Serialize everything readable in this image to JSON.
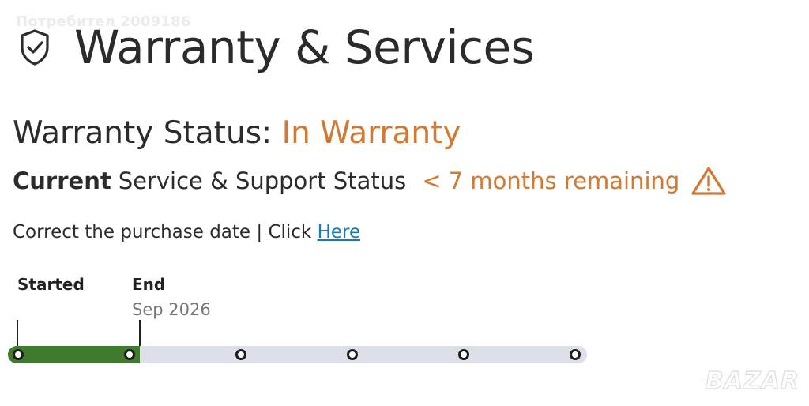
{
  "watermark_top": "Потребител 2009186",
  "header": {
    "icon": "shield-check-icon",
    "title": "Warranty & Services"
  },
  "warranty": {
    "label": "Warranty Status:",
    "value": "In Warranty"
  },
  "support": {
    "current": "Current",
    "label": "Service & Support Status",
    "remaining": "< 7 months remaining",
    "icon": "warning-icon"
  },
  "correct": {
    "text": "Correct the purchase date | Click",
    "link": "Here"
  },
  "timeline": {
    "start_label": "Started",
    "end_label": "End",
    "end_date": "Sep 2026",
    "progress_fraction": 0.228,
    "milestones": 6
  },
  "colors": {
    "accent_orange": "#d07a35",
    "progress_green": "#3f7d2c",
    "track_gray": "#dde0e8",
    "link_blue": "#1b79b5"
  },
  "watermark_brand": "BAZAR"
}
